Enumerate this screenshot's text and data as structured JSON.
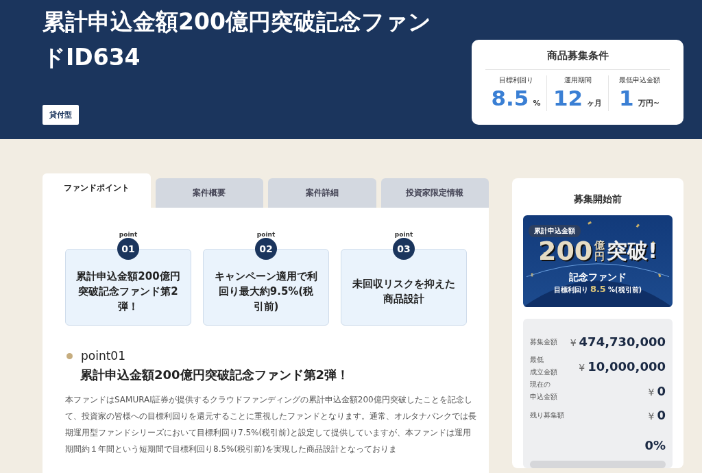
{
  "header": {
    "title": "累計申込金額200億円突破記念ファンドID634",
    "badge": "貸付型"
  },
  "conditions": {
    "title": "商品募集条件",
    "items": [
      {
        "label": "目標利回り",
        "value": "8.5",
        "unit": "%"
      },
      {
        "label": "運用期間",
        "value": "12",
        "unit": "ヶ月"
      },
      {
        "label": "最低申込金額",
        "value": "1",
        "unit": "万円~"
      }
    ]
  },
  "tabs": [
    {
      "label": "ファンドポイント",
      "selected": true
    },
    {
      "label": "案件概要",
      "selected": false
    },
    {
      "label": "案件詳細",
      "selected": false
    },
    {
      "label": "投資家限定情報",
      "selected": false
    }
  ],
  "points": [
    {
      "label": "point",
      "number": "01",
      "text": "累計申込金額200億円突破記念ファンド第2弾！"
    },
    {
      "label": "point",
      "number": "02",
      "text": "キャンペーン適用で利回り最大約9.5%(税引前)"
    },
    {
      "label": "point",
      "number": "03",
      "text": "未回収リスクを抑えた商品設計"
    }
  ],
  "section": {
    "point_label": "point01",
    "heading": "累計申込金額200億円突破記念ファンド第2弾！",
    "paragraph": "本ファンドはSAMURAI証券が提供するクラウドファンディングの累計申込金額200億円突破したことを記念して、投資家の皆様への目標利回りを還元することに重視したファンドとなります。通常、オルタナバンクでは長期運用型ファンドシリーズにおいて目標利回り7.5%(税引前)と設定して提供していますが、本ファンドは運用期間約１年間という短期間で目標利回り8.5%(税引前)を実現した商品設計となっておりま"
  },
  "sidebar": {
    "status": "募集開始前",
    "banner": {
      "tag": "累計申込金額",
      "number": "200",
      "unit_top": "億",
      "unit_bottom": "円",
      "headline": "突破!",
      "title": "記念ファンド",
      "rate_label": "目標利回り",
      "rate_value": "8.5",
      "rate_unit": "%(税引前)"
    },
    "stats": [
      {
        "label": [
          "募集金額"
        ],
        "currency": "¥",
        "amount": "474,730,000"
      },
      {
        "label": [
          "最低",
          "成立金額"
        ],
        "currency": "¥",
        "amount": "10,000,000"
      },
      {
        "label": [
          "現在の",
          "申込金額"
        ],
        "currency": "¥",
        "amount": "0"
      },
      {
        "label": [
          "残り募集額"
        ],
        "currency": "¥",
        "amount": "0"
      }
    ],
    "progress": {
      "percent": "0%",
      "level": 0
    }
  }
}
